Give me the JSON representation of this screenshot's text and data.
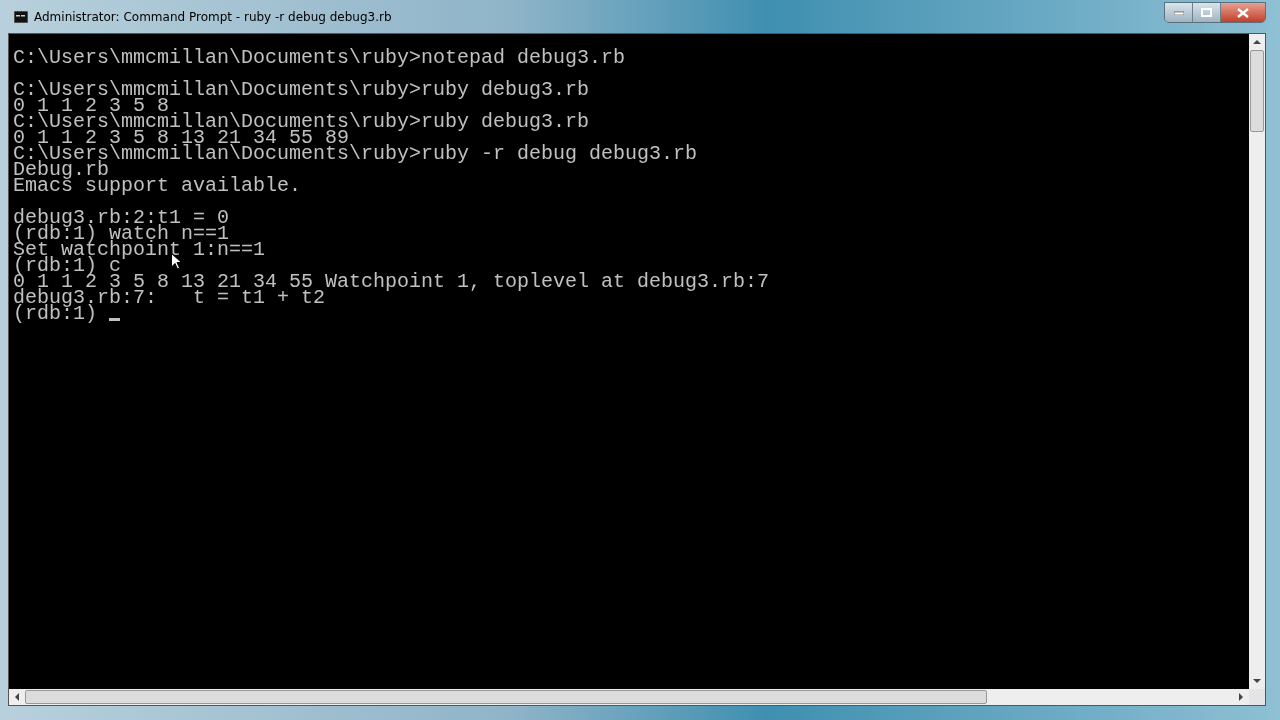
{
  "window": {
    "title": "Administrator: Command Prompt - ruby  -r debug debug3.rb"
  },
  "console": {
    "lines": [
      {
        "text": "C:\\Users\\mmcmillan\\Documents\\ruby>notepad debug3.rb",
        "gap_before": false,
        "cursor": false
      },
      {
        "text": "C:\\Users\\mmcmillan\\Documents\\ruby>ruby debug3.rb",
        "gap_before": true,
        "cursor": false
      },
      {
        "text": "0 1 1 2 3 5 8",
        "gap_before": false,
        "cursor": false
      },
      {
        "text": "C:\\Users\\mmcmillan\\Documents\\ruby>ruby debug3.rb",
        "gap_before": false,
        "cursor": false
      },
      {
        "text": "0 1 1 2 3 5 8 13 21 34 55 89",
        "gap_before": false,
        "cursor": false
      },
      {
        "text": "C:\\Users\\mmcmillan\\Documents\\ruby>ruby -r debug debug3.rb",
        "gap_before": false,
        "cursor": false
      },
      {
        "text": "Debug.rb",
        "gap_before": false,
        "cursor": false
      },
      {
        "text": "Emacs support available.",
        "gap_before": false,
        "cursor": false
      },
      {
        "text": "debug3.rb:2:t1 = 0",
        "gap_before": true,
        "cursor": false
      },
      {
        "text": "(rdb:1) watch n==1",
        "gap_before": false,
        "cursor": false
      },
      {
        "text": "Set watchpoint 1:n==1",
        "gap_before": false,
        "cursor": false
      },
      {
        "text": "(rdb:1) c",
        "gap_before": false,
        "cursor": false
      },
      {
        "text": "0 1 1 2 3 5 8 13 21 34 55 Watchpoint 1, toplevel at debug3.rb:7",
        "gap_before": false,
        "cursor": false
      },
      {
        "text": "debug3.rb:7:   t = t1 + t2",
        "gap_before": false,
        "cursor": false
      },
      {
        "text": "(rdb:1) ",
        "gap_before": false,
        "cursor": true
      }
    ]
  }
}
